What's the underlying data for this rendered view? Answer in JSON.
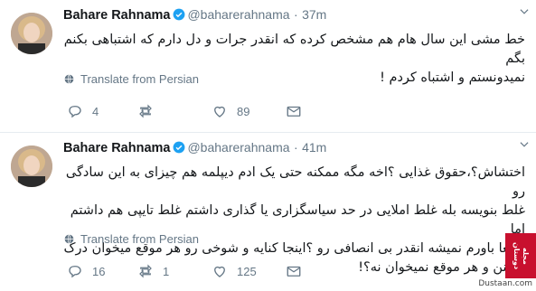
{
  "colors": {
    "verified_blue": "#1da1f2",
    "meta_gray": "#657786",
    "divider": "#e6ecf0",
    "stamp_red": "#c8102e"
  },
  "tweets": [
    {
      "name": "Bahare Rahnama",
      "handle": "@baharerahnama",
      "dot": "·",
      "time": "37m",
      "text_line1": "خط مشی این سال هام هم مشخص کرده که انقدر جرات و دل دارم که اشتباهی بکنم بگم",
      "text_line2": "نمیدونستم و اشتباه کردم !",
      "translate": "Translate from Persian",
      "replies": "4",
      "retweets": "",
      "likes": "89",
      "icons": [
        "reply-icon",
        "retweet-icon",
        "like-icon",
        "message-icon"
      ]
    },
    {
      "name": "Bahare Rahnama",
      "handle": "@baharerahnama",
      "dot": "·",
      "time": "41m",
      "text_line1": "اختشاش؟،حقوق غذایی ؟اخه مگه ممکنه حتی یک ادم دیپلمه هم چیزای به این سادگی رو",
      "text_line2": "غلط بنویسه بله غلط املایی در حد سیاسگزاری یا گذاری داشتم غلط تایپی هم داشتم اما",
      "text_line3": "واقعا باورم نمیشه انقدر بی انصافی رو ؟اینجا کنایه و شوخی رو هر موقع میخوان درک",
      "text_line4": "میکنن و هر موقع نمیخوان نه؟!",
      "translate": "Translate from Persian",
      "replies": "16",
      "retweets": "1",
      "likes": "125",
      "icons": [
        "reply-icon",
        "retweet-icon",
        "like-icon",
        "message-icon"
      ]
    }
  ],
  "stamp_text": "مجله دوستان",
  "watermark": "Dustaan.com"
}
